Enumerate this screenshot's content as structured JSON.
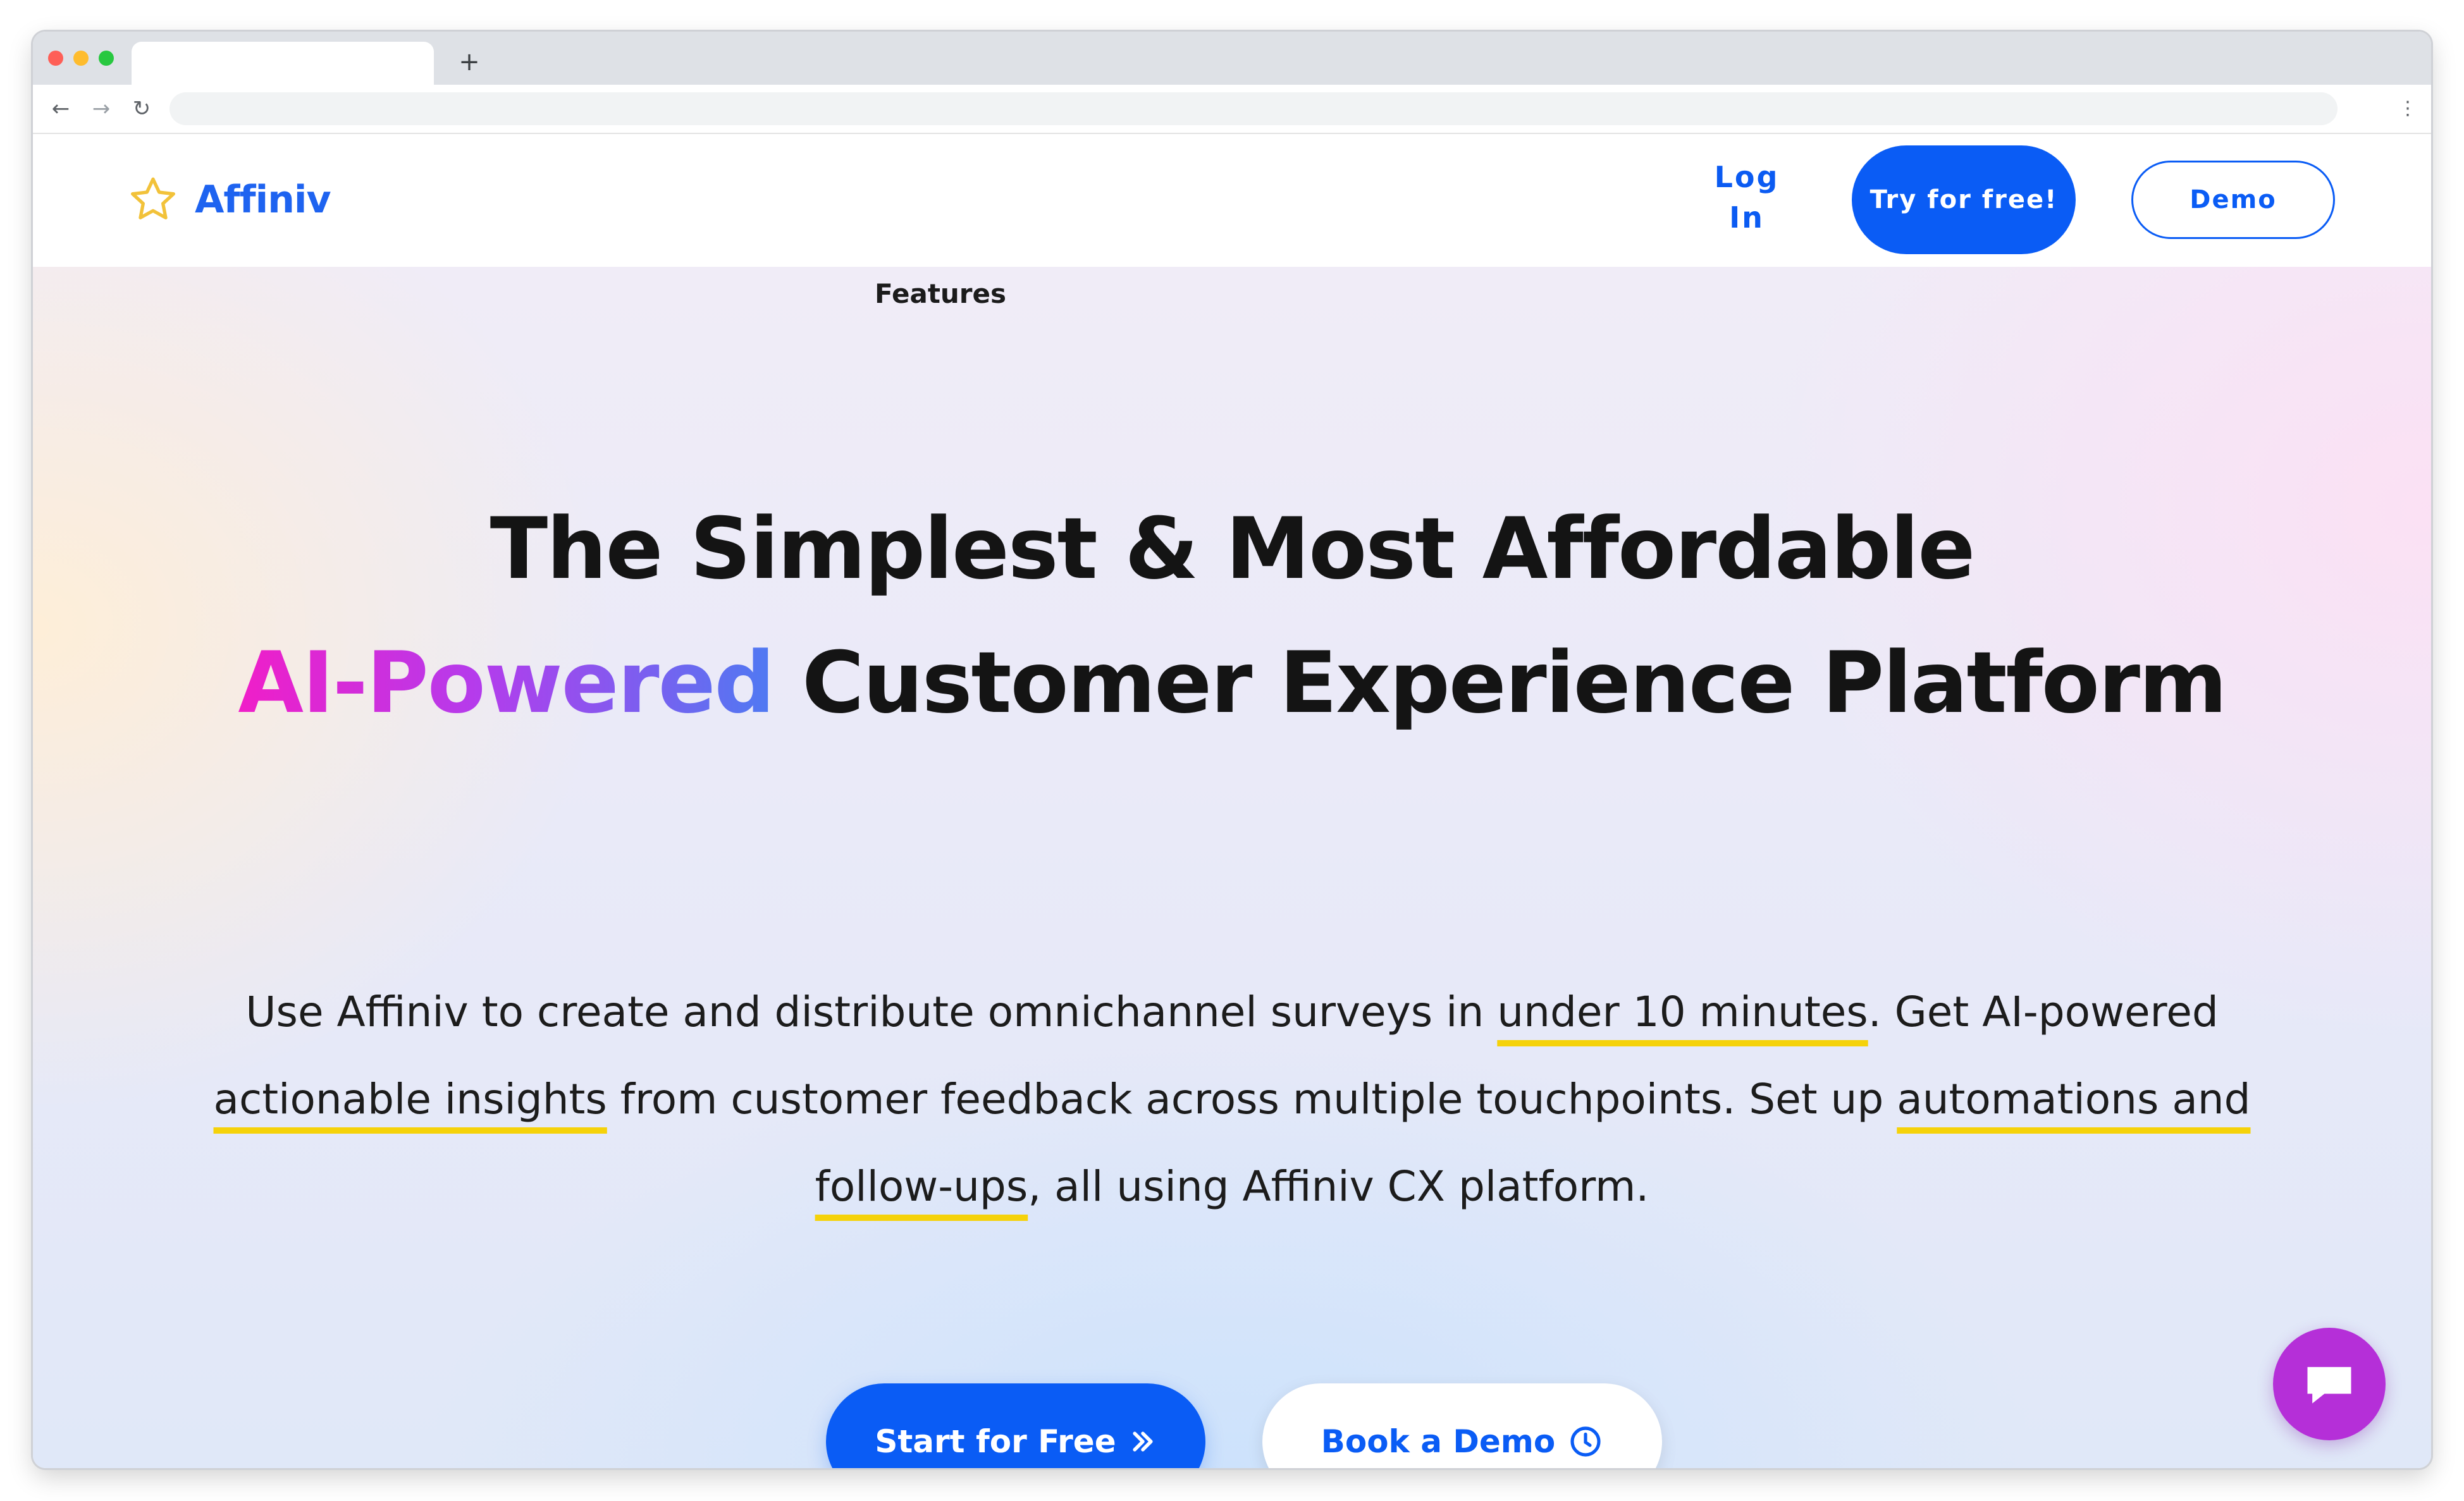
{
  "browser": {
    "tab_title": "",
    "new_tab_symbol": "+",
    "url": "",
    "back_symbol": "←",
    "forward_symbol": "→",
    "reload_symbol": "↻",
    "menu_symbol": "⋮"
  },
  "header": {
    "logo_text": "Affiniv",
    "logo_icon": "star-icon",
    "login_label": "Log In",
    "try_label": "Try for free!",
    "demo_label": "Demo"
  },
  "nav": {
    "features_label": "Features"
  },
  "hero": {
    "headline_line1": "The Simplest & Most Affordable",
    "headline_highlight": "AI-Powered",
    "headline_rest": " Customer Experience Platform",
    "subtext": {
      "part1": "Use Affiniv to create and distribute omnichannel surveys in ",
      "hl1": "under 10 minutes",
      "part2": ". Get AI-powered ",
      "hl2": "actionable insights",
      "part3": " from customer feedback across multiple touchpoints. Set up ",
      "hl3": "automations and follow-ups",
      "part4": ", all using Affiniv CX platform."
    },
    "cta_primary_label": "Start for Free",
    "cta_primary_icon": "double-chevron-right-icon",
    "cta_secondary_label": "Book a Demo",
    "cta_secondary_icon": "clock-icon"
  },
  "chat": {
    "icon": "chat-bubble-icon"
  },
  "colors": {
    "brand_blue": "#0a5cf5",
    "gradient_start": "#f01ec8",
    "gradient_end": "#4e7af2",
    "underline_yellow": "#f5d20a",
    "chat_purple": "#b52fd8"
  }
}
